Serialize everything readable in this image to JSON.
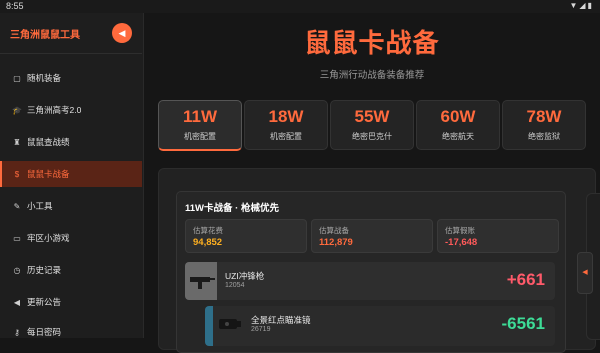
{
  "status_bar": {
    "time": "8:55",
    "icons": "▼◢▮"
  },
  "sidebar": {
    "brand": "三角洲鼠鼠工具",
    "collapse_icon": "◀",
    "items": [
      {
        "label": "随机装备",
        "icon": "▢"
      },
      {
        "label": "三角洲高考2.0",
        "icon": "🎓"
      },
      {
        "label": "鼠鼠查战绩",
        "icon": "♜"
      },
      {
        "label": "鼠鼠卡战备",
        "icon": "$"
      },
      {
        "label": "小工具",
        "icon": "✎"
      },
      {
        "label": "牢区小游戏",
        "icon": "▭"
      },
      {
        "label": "历史记录",
        "icon": "◷"
      },
      {
        "label": "更新公告",
        "icon": "◀"
      },
      {
        "label": "每日密码",
        "icon": "⚷"
      }
    ]
  },
  "main": {
    "title": "鼠鼠卡战备",
    "subtitle": "三角洲行动战备装备推荐",
    "tabs": [
      {
        "amount": "11W",
        "label": "机密配置"
      },
      {
        "amount": "18W",
        "label": "机密配置"
      },
      {
        "amount": "55W",
        "label": "绝密巴克什"
      },
      {
        "amount": "60W",
        "label": "绝密航天"
      },
      {
        "amount": "78W",
        "label": "绝密监狱"
      }
    ],
    "active_tab": 0,
    "loadout": {
      "title": "11W卡战备 · 枪械优先",
      "stats": [
        {
          "label": "估算花费",
          "value": "94,852",
          "color": "#ffb020"
        },
        {
          "label": "估算战备",
          "value": "112,879",
          "color": "#ff6a3d"
        },
        {
          "label": "估算假账",
          "value": "-17,648",
          "color": "#ff5a5a"
        }
      ],
      "items": [
        {
          "name": "UZI冲锋枪",
          "id": "12054",
          "value": "+661",
          "color": "#ff5a6a"
        },
        {
          "name": "全景红点瞄准镜",
          "id": "26719",
          "value": "-6561",
          "color": "#3ddc97"
        }
      ]
    },
    "side_handle_icon": "◀"
  },
  "colors": {
    "accent": "#ff6a3d",
    "positive": "#ff5a6a",
    "negative": "#3ddc97"
  }
}
